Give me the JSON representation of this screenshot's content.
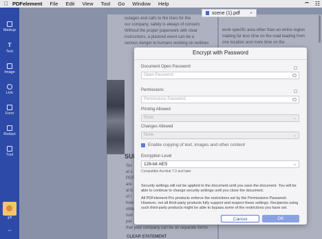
{
  "menubar": {
    "app_name": "PDFelement",
    "items": [
      "File",
      "Edit",
      "View",
      "Tool",
      "Go",
      "Window",
      "Help"
    ]
  },
  "tab": {
    "title": "scene (1).pdf"
  },
  "sidebar": {
    "tools": [
      {
        "label": "Markup",
        "icon": "markup-icon"
      },
      {
        "label": "Text",
        "icon": "text-icon"
      },
      {
        "label": "Image",
        "icon": "image-icon"
      },
      {
        "label": "Link",
        "icon": "link-icon"
      },
      {
        "label": "Form",
        "icon": "form-icon"
      },
      {
        "label": "Redact",
        "icon": "redact-icon"
      },
      {
        "label": "Tool",
        "icon": "tool-icon"
      }
    ]
  },
  "document": {
    "left_lines": [
      "outages and calls to fire lines for the",
      "our company, safety is always of concern.",
      "Without the proper paperwork with clear",
      "instructions, a planned event can be a",
      "serious danger to humans working on outlines"
    ],
    "right_lines": [
      "work specific area other than an entire region",
      "making far less time on the road leading from",
      "one location and more time on the"
    ],
    "heading": "SUI",
    "side_letters": [
      "Scr",
      "at s",
      "PDF",
      "are",
      "al b",
      "of l",
      "how",
      "obta",
      "ruin",
      "per"
    ],
    "bottom_line": "that your company can be on separate forms",
    "bottom_heading": "CLEAR STATEMENT"
  },
  "dialog": {
    "title": "Encrypt with Password",
    "open_password_label": "Document Open Password",
    "open_password_placeholder": "Open Password",
    "permissions_label": "Permissions",
    "permissions_placeholder": "Permissions Password",
    "printing_label": "Printing Allowed",
    "printing_value": "None",
    "changes_label": "Changes Allowed",
    "changes_value": "None",
    "copy_checkbox_label": "Enable copying of text, images and other content",
    "encryption_label": "Encryption Level",
    "encryption_value": "128-bit AES",
    "compat_text": "Compatible Acrobat 7.0 and later",
    "note1": "Security settings will not be applied to the document until you save the document. You will be able to continue to change security settings until you close the document.",
    "note2": "All PDFelement Pro products enforce the restrictions set by the Permissions Password. However, not all third-party products fully support and respect these settings. Recipients using such third-party products might be able to bypass some of the restrictions you have set.",
    "cancel_label": "Cancel",
    "ok_label": "OK"
  },
  "colors": {
    "sidebar": "#2d4aa8",
    "accent": "#5b7bd5",
    "ok_button": "#8aa1e4"
  }
}
